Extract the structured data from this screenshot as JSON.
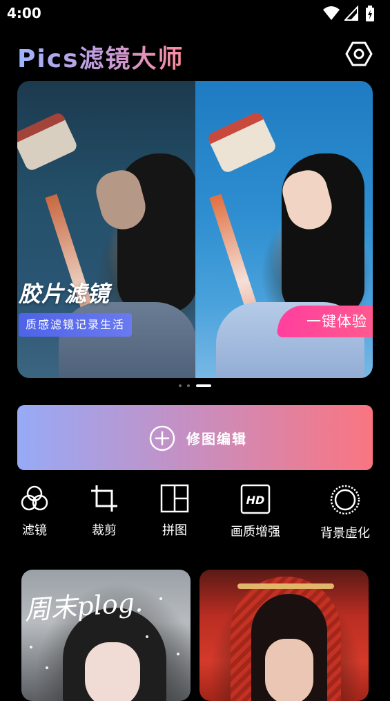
{
  "status_bar": {
    "time": "4:00",
    "icons": [
      "wifi-icon",
      "signal-icon",
      "battery-charging-icon"
    ]
  },
  "header": {
    "title": "Pics滤镜大师",
    "settings_icon": "settings-hexagon-icon",
    "title_gradient": [
      "#9fb4ff",
      "#c79ad8",
      "#ff8a9a"
    ]
  },
  "banner": {
    "title": "胶片滤镜",
    "tag": "质感滤镜记录生活",
    "cta": "一键体验",
    "page_count": 3,
    "active_page": 3,
    "cta_color": "#ff3f9e",
    "tag_color": "#4e63e8"
  },
  "edit_button": {
    "label": "修图编辑",
    "icon": "plus-circle-icon",
    "gradient": [
      "#97aaf7",
      "#c88ec0",
      "#fa7580"
    ]
  },
  "tools": [
    {
      "label": "滤镜",
      "icon": "filter-circles-icon"
    },
    {
      "label": "裁剪",
      "icon": "crop-icon"
    },
    {
      "label": "拼图",
      "icon": "collage-grid-icon"
    },
    {
      "label": "画质增强",
      "icon": "hd-icon"
    },
    {
      "label": "背景虚化",
      "icon": "blur-circle-icon"
    }
  ],
  "cards": [
    {
      "caption": "周末plog."
    },
    {
      "caption": ""
    }
  ]
}
